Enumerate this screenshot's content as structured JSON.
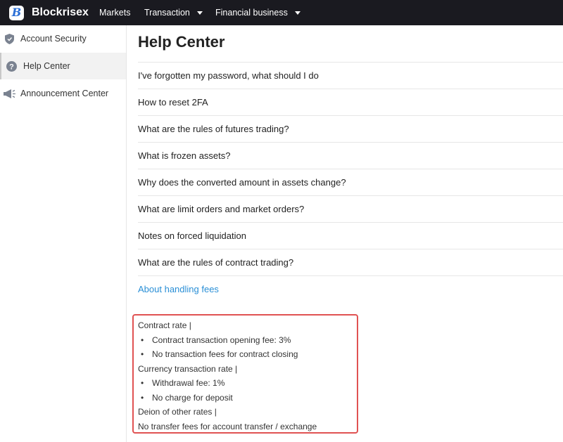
{
  "brand": {
    "name": "Blockrisex",
    "logo_letter": "B"
  },
  "nav": {
    "items": [
      {
        "label": "Markets",
        "has_dropdown": false
      },
      {
        "label": "Transaction",
        "has_dropdown": true
      },
      {
        "label": "Financial business",
        "has_dropdown": true
      }
    ]
  },
  "sidebar": {
    "items": [
      {
        "label": "Account Security",
        "icon": "shield-icon",
        "active": false
      },
      {
        "label": "Help Center",
        "icon": "question-circle-icon",
        "active": true
      },
      {
        "label": "Announcement Center",
        "icon": "megaphone-icon",
        "active": false
      }
    ]
  },
  "main": {
    "title": "Help Center",
    "faqs": [
      "I've forgotten my password, what should I do",
      "How to reset 2FA",
      "What are the rules of futures trading?",
      "What is frozen assets?",
      "Why does the converted amount in assets change?",
      "What are limit orders and market orders?",
      "Notes on forced liquidation",
      "What are the rules of contract trading?"
    ],
    "active_faq": "About handling fees",
    "fee_details": [
      {
        "text": "Contract rate |",
        "bullet": false
      },
      {
        "text": "Contract transaction opening fee: 3%",
        "bullet": true
      },
      {
        "text": "No transaction fees for contract closing",
        "bullet": true
      },
      {
        "text": "Currency transaction rate |",
        "bullet": false
      },
      {
        "text": "Withdrawal fee: 1%",
        "bullet": true
      },
      {
        "text": "No charge for deposit",
        "bullet": true
      },
      {
        "text": "Deion of other rates |",
        "bullet": false
      },
      {
        "text": "No transfer fees for account transfer / exchange",
        "bullet": false
      }
    ]
  },
  "colors": {
    "topbar": "#1a1a20",
    "link": "#2a8fd6",
    "highlight_border": "#e05252",
    "logo": "#2b6fd6"
  }
}
